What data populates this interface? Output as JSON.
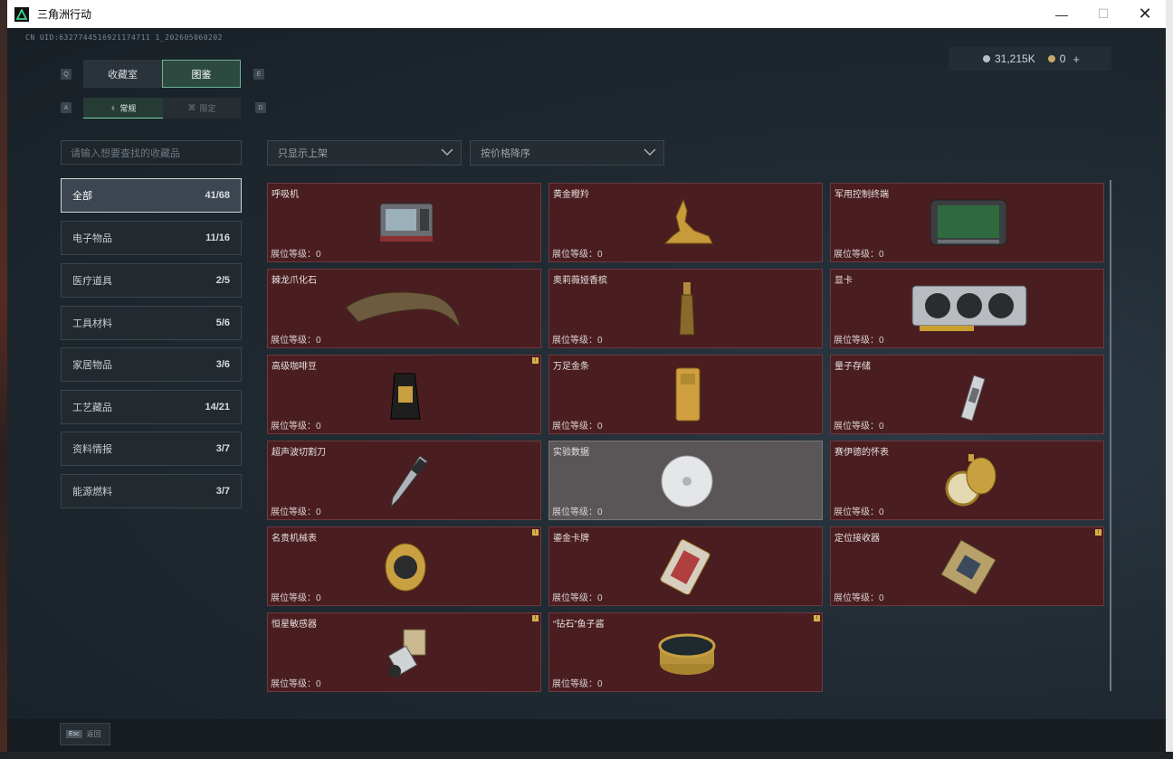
{
  "window": {
    "title": "三角洲行动"
  },
  "uid": "CN UID:6327744516921174711 1_202605060202",
  "currency": {
    "silver": "31,215K",
    "gold": "0",
    "plus": "+"
  },
  "keys": {
    "q": "Q",
    "e": "E",
    "a": "A",
    "d": "D"
  },
  "tabs": {
    "collection": "收藏室",
    "catalog": "图鉴"
  },
  "subtabs": {
    "normal": "常规",
    "limited": "限定"
  },
  "search": {
    "placeholder": "请输入想要查找的收藏品"
  },
  "filters": {
    "shelf": "只显示上架",
    "sort": "按价格降序"
  },
  "categories": [
    {
      "label": "全部",
      "count": "41/68"
    },
    {
      "label": "电子物品",
      "count": "11/16"
    },
    {
      "label": "医疗道具",
      "count": "2/5"
    },
    {
      "label": "工具材料",
      "count": "5/6"
    },
    {
      "label": "家居物品",
      "count": "3/6"
    },
    {
      "label": "工艺藏品",
      "count": "14/21"
    },
    {
      "label": "资料情报",
      "count": "3/7"
    },
    {
      "label": "能源燃料",
      "count": "3/7"
    }
  ],
  "items": [
    {
      "name": "呼吸机",
      "level": "展位等级：0"
    },
    {
      "name": "黄金瞪羚",
      "level": "展位等级：0"
    },
    {
      "name": "军用控制终端",
      "level": "展位等级：0"
    },
    {
      "name": "棘龙爪化石",
      "level": "展位等级：0"
    },
    {
      "name": "奥莉薇娅香槟",
      "level": "展位等级：0"
    },
    {
      "name": "显卡",
      "level": "展位等级：0"
    },
    {
      "name": "高级咖啡豆",
      "level": "展位等级：0"
    },
    {
      "name": "万足金条",
      "level": "展位等级：0"
    },
    {
      "name": "量子存储",
      "level": "展位等级：0"
    },
    {
      "name": "超声波切割刀",
      "level": "展位等级：0"
    },
    {
      "name": "实验数据",
      "level": "展位等级：0"
    },
    {
      "name": "赛伊德的怀表",
      "level": "展位等级：0"
    },
    {
      "name": "名贵机械表",
      "level": "展位等级：0"
    },
    {
      "name": "鎏金卡牌",
      "level": "展位等级：0"
    },
    {
      "name": "定位接收器",
      "level": "展位等级：0"
    },
    {
      "name": "恒星敏感器",
      "level": "展位等级：0"
    },
    {
      "name": "“钻石”鱼子酱",
      "level": "展位等级：0"
    }
  ],
  "badge": "!",
  "footer": {
    "esc_key": "Esc",
    "back": "返回"
  },
  "colors": {
    "card": "#4a1d21",
    "accent": "#6db394",
    "badge": "#d7b14a"
  }
}
